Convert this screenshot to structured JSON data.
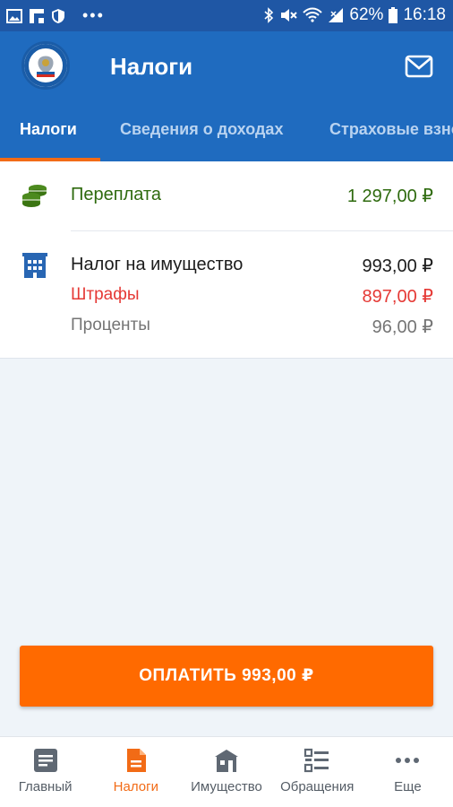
{
  "status_bar": {
    "battery": "62%",
    "time": "16:18"
  },
  "header": {
    "title": "Налоги"
  },
  "tabs": [
    {
      "label": "Налоги",
      "active": true
    },
    {
      "label": "Сведения о доходах",
      "active": false
    },
    {
      "label": "Страховые взносы",
      "active": false
    }
  ],
  "overpayment": {
    "label": "Переплата",
    "amount": "1 297,00 ₽"
  },
  "property_tax": {
    "label": "Налог на имущество",
    "amount": "993,00 ₽",
    "fines_label": "Штрафы",
    "fines_amount": "897,00 ₽",
    "interest_label": "Проценты",
    "interest_amount": "96,00 ₽"
  },
  "pay_button": {
    "label": "ОПЛАТИТЬ 993,00 ₽"
  },
  "bottom_nav": [
    {
      "label": "Главный",
      "icon": "document-icon",
      "active": false
    },
    {
      "label": "Налоги",
      "icon": "tax-document-icon",
      "active": true
    },
    {
      "label": "Имущество",
      "icon": "building-icon",
      "active": false
    },
    {
      "label": "Обращения",
      "icon": "list-icon",
      "active": false
    },
    {
      "label": "Еще",
      "icon": "more-icon",
      "active": false
    }
  ],
  "colors": {
    "primary": "#1f6bbf",
    "status_bar": "#1f57a5",
    "accent": "#ff6a00",
    "overpayment": "#2e6a0e",
    "fines": "#e53935",
    "muted": "#757575"
  }
}
